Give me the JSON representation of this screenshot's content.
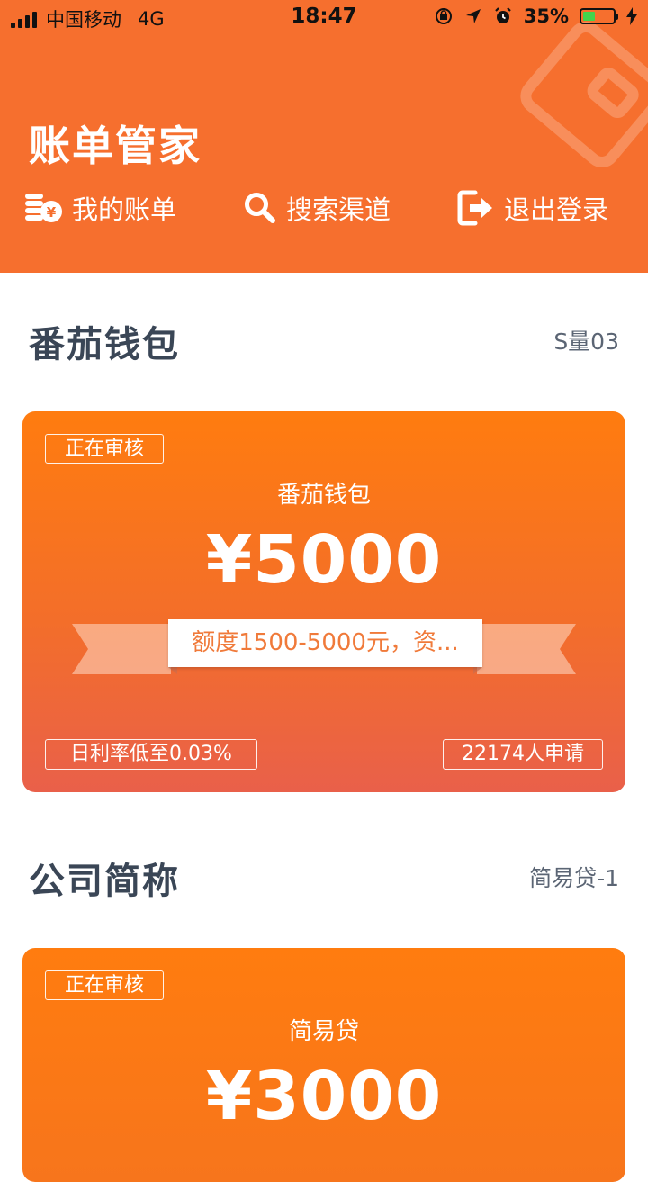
{
  "status_bar": {
    "carrier": "中国移动",
    "network": "4G",
    "time": "18:47",
    "battery": "35%",
    "battery_level": 0.35
  },
  "header": {
    "title": "账单管家",
    "nav": [
      {
        "label": "我的账单",
        "icon": "coins-yen-icon"
      },
      {
        "label": "搜索渠道",
        "icon": "search-icon"
      },
      {
        "label": "退出登录",
        "icon": "logout-icon"
      }
    ],
    "accent": "#f66f2e"
  },
  "sections": [
    {
      "title": "番茄钱包",
      "subtitle": "S量03",
      "card": {
        "status": "正在审核",
        "name": "番茄钱包",
        "amount": "¥5000",
        "banner": "额度1500-5000元，资...",
        "rate": "日利率低至0.03%",
        "applicants": "22174人申请"
      }
    },
    {
      "title": "公司简称",
      "subtitle": "简易贷-1",
      "card": {
        "status": "正在审核",
        "name": "简易贷",
        "amount": "¥3000"
      }
    }
  ]
}
